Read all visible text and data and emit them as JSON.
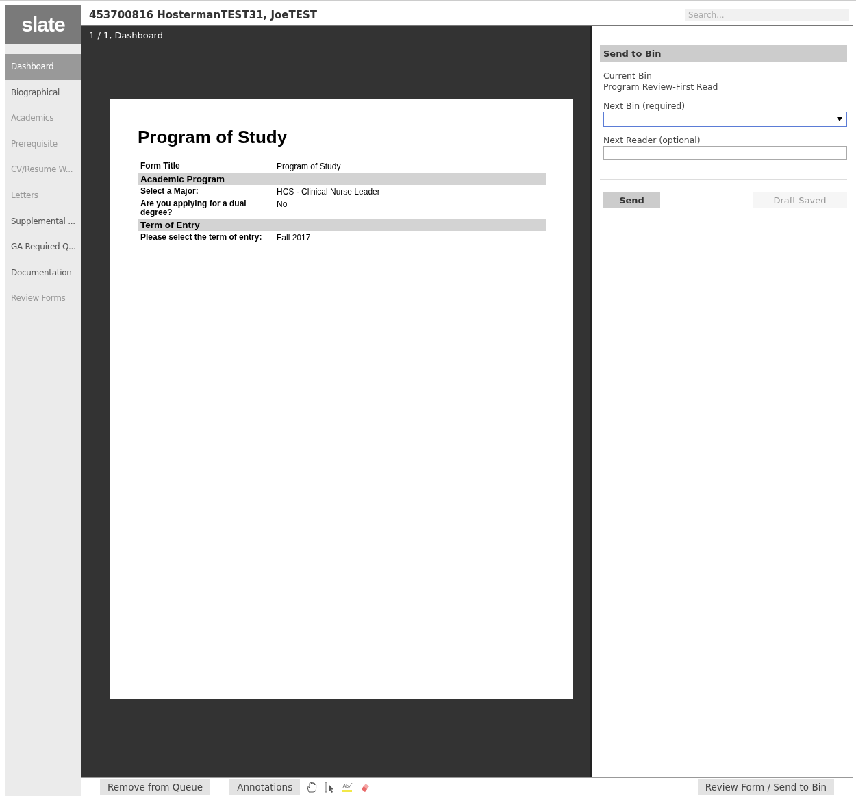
{
  "logo": "slate",
  "header": {
    "title": "453700816 HostermanTEST31, JoeTEST",
    "search": {
      "placeholder": "Search..."
    }
  },
  "sidebar": {
    "items": [
      {
        "label": "Dashboard",
        "selected": true,
        "disabled": false
      },
      {
        "label": "Biographical",
        "selected": false,
        "disabled": false
      },
      {
        "label": "Academics",
        "selected": false,
        "disabled": true
      },
      {
        "label": "Prerequisite",
        "selected": false,
        "disabled": true
      },
      {
        "label": "CV/Resume W...",
        "selected": false,
        "disabled": true
      },
      {
        "label": "Letters",
        "selected": false,
        "disabled": true
      },
      {
        "label": "Supplemental ...",
        "selected": false,
        "disabled": false
      },
      {
        "label": "GA Required Q...",
        "selected": false,
        "disabled": false
      },
      {
        "label": "Documentation",
        "selected": false,
        "disabled": false
      },
      {
        "label": "Review Forms",
        "selected": false,
        "disabled": true
      }
    ]
  },
  "viewer": {
    "page_indicator": "1 / 1, Dashboard",
    "document": {
      "title": "Program of Study",
      "rows": [
        {
          "kind": "field",
          "label": "Form Title",
          "value": "Program of Study"
        },
        {
          "kind": "section",
          "label": "Academic Program"
        },
        {
          "kind": "field",
          "label": "Select a Major:",
          "value": "HCS - Clinical Nurse Leader"
        },
        {
          "kind": "field",
          "label": "Are you applying for a dual degree?",
          "value": "No"
        },
        {
          "kind": "section",
          "label": "Term of Entry"
        },
        {
          "kind": "field",
          "label": "Please select the term of entry:",
          "value": "Fall 2017"
        }
      ]
    }
  },
  "panel": {
    "title": "Send to Bin",
    "current_bin_label": "Current Bin",
    "current_bin": "Program Review-First Read",
    "next_bin_label": "Next Bin (required)",
    "next_reader_label": "Next Reader (optional)",
    "send_button": "Send",
    "draft_status": "Draft Saved"
  },
  "bottom_bar": {
    "left_buttons": [
      "Remove from Queue",
      "Annotations"
    ],
    "right_button": "Review Form / Send to Bin"
  }
}
